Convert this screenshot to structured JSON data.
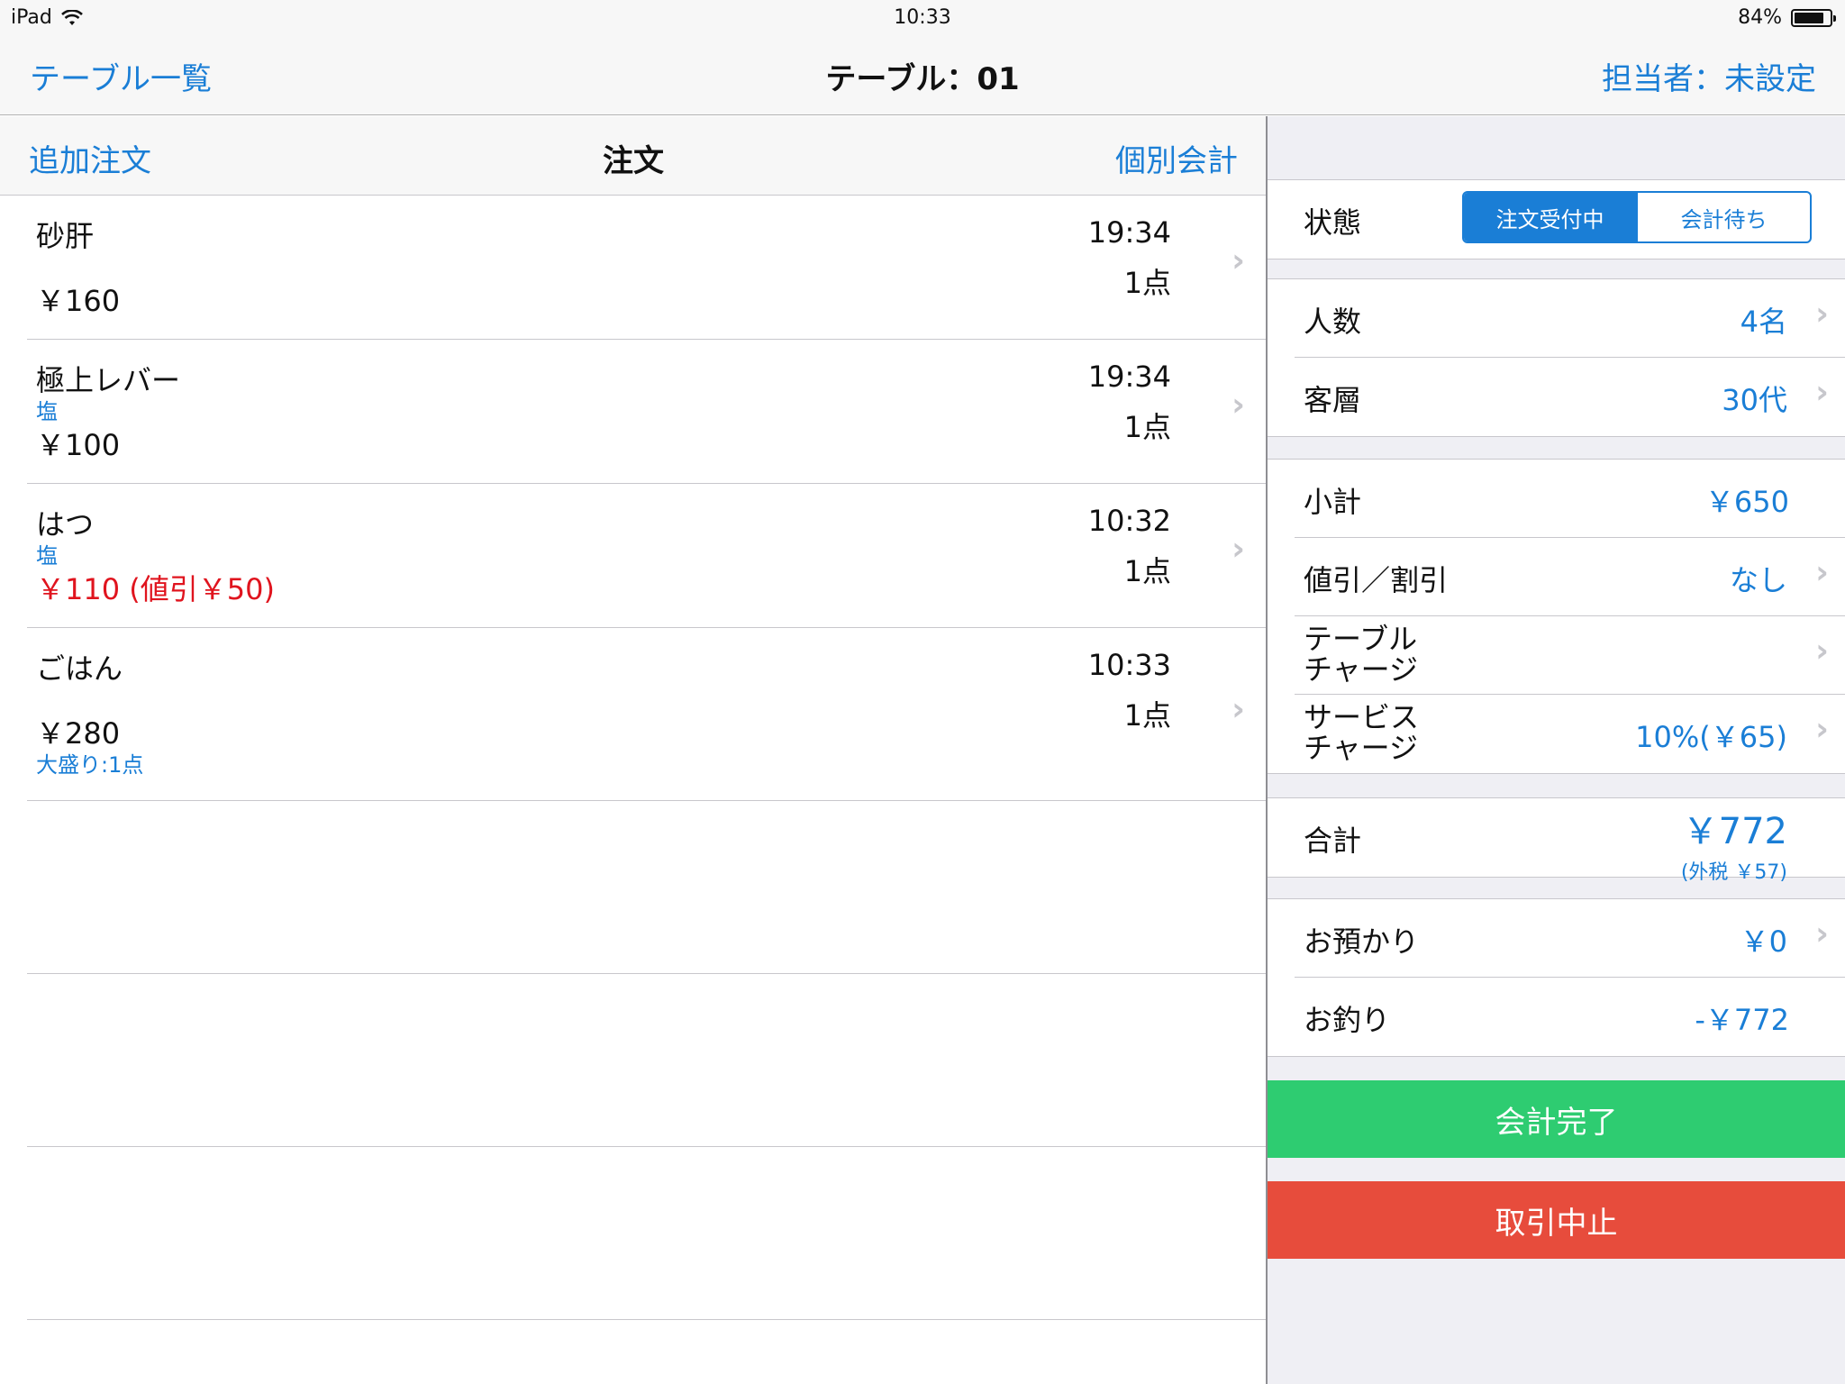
{
  "status_bar": {
    "device": "iPad",
    "time": "10:33",
    "battery": "84%",
    "battery_level": 0.84
  },
  "nav": {
    "back_label": "テーブル一覧",
    "title": "テーブル：01",
    "staff_label": "担当者：未設定"
  },
  "orders_bar": {
    "add_label": "追加注文",
    "title": "注文",
    "individual_label": "個別会計"
  },
  "orders": [
    {
      "name": "砂肝",
      "option": "",
      "price": "￥160",
      "time": "19:34",
      "qty": "1点",
      "extra": ""
    },
    {
      "name": "極上レバー",
      "option": "塩",
      "price": "￥100",
      "time": "19:34",
      "qty": "1点",
      "extra": ""
    },
    {
      "name": "はつ",
      "option": "塩",
      "price": "￥110 (値引￥50)",
      "time": "10:32",
      "qty": "1点",
      "extra": ""
    },
    {
      "name": "ごはん",
      "option": "",
      "price": "￥280",
      "time": "10:33",
      "qty": "1点",
      "extra": "大盛り:1点"
    }
  ],
  "summary": {
    "state_label": "状態",
    "state_options": [
      "注文受付中",
      "会計待ち"
    ],
    "state_selected": "注文受付中",
    "people_label": "人数",
    "people_value": "4名",
    "customer_label": "客層",
    "customer_value": "30代",
    "subtotal_label": "小計",
    "subtotal_value": "￥650",
    "discount_label": "値引／割引",
    "discount_value": "なし",
    "table_charge_label_1": "テーブル",
    "table_charge_label_2": "チャージ",
    "service_charge_label_1": "サービス",
    "service_charge_label_2": "チャージ",
    "service_charge_value": "10%(￥65)",
    "total_label": "合計",
    "total_value": "￥772",
    "total_tax": "(外税 ￥57)",
    "deposit_label": "お預かり",
    "deposit_value": "￥0",
    "change_label": "お釣り",
    "change_value": "-￥772"
  },
  "actions": {
    "complete_label": "会計完了",
    "cancel_label": "取引中止"
  },
  "colors": {
    "accent": "#1a7ed6",
    "discount": "#e0141e",
    "complete": "#2ecc71",
    "cancel": "#e74c3c"
  }
}
